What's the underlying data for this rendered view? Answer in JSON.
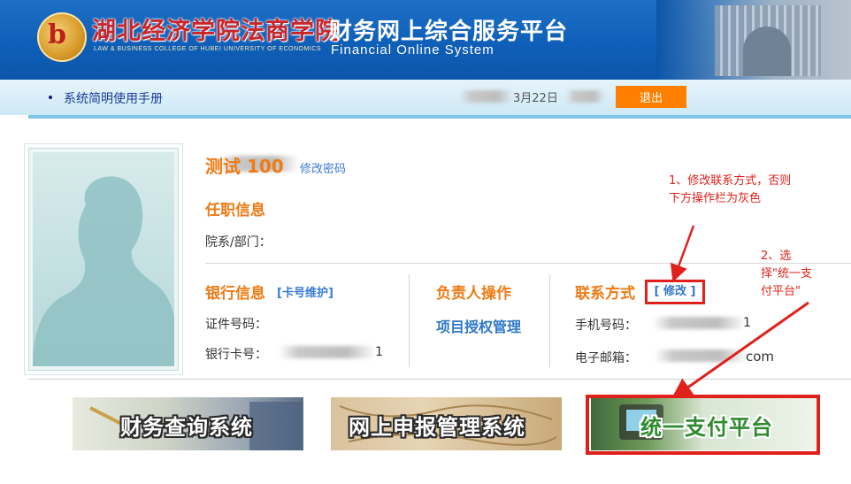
{
  "header": {
    "logo_char": "b",
    "school_name": "湖北经济学院法商学院",
    "school_name_en": "LAW & BUSINESS COLLEGE OF HUBEI UNIVERSITY OF ECONOMICS",
    "system_title": "财务网上综合服务平台",
    "system_title_en": "Financial Online System"
  },
  "topbar": {
    "manual_link": "系统简明使用手册",
    "date_fragment": "3月22日",
    "logout_label": "退出"
  },
  "profile": {
    "name_fragment": "测试 100",
    "change_password": "修改密码",
    "employment_title": "任职信息",
    "department_label": "院系/部门："
  },
  "bank": {
    "title": "银行信息",
    "card_maintain": "[卡号维护]",
    "id_label": "证件号码：",
    "card_label": "银行卡号：",
    "card_tail": "1"
  },
  "manager": {
    "title": "负责人操作",
    "auth_link": "项目授权管理"
  },
  "contact": {
    "title": "联系方式",
    "edit": "[ 修改 ]",
    "phone_label": "手机号码：",
    "phone_tail": "1",
    "email_label": "电子邮箱：",
    "email_tail": "com"
  },
  "annotations": {
    "note1": "1、修改联系方式，否则下方操作栏为灰色",
    "note2": "2、选择\"统一支付平台\""
  },
  "banners": [
    {
      "label": "财务查询系统"
    },
    {
      "label": "网上申报管理系统"
    },
    {
      "label": "统一支付平台"
    }
  ],
  "colors": {
    "header_blue": "#0f5fb8",
    "accent_orange": "#f07a14",
    "logout_orange": "#ff7f00",
    "annotation_red": "#e0201a",
    "link_blue": "#2f78c8"
  }
}
